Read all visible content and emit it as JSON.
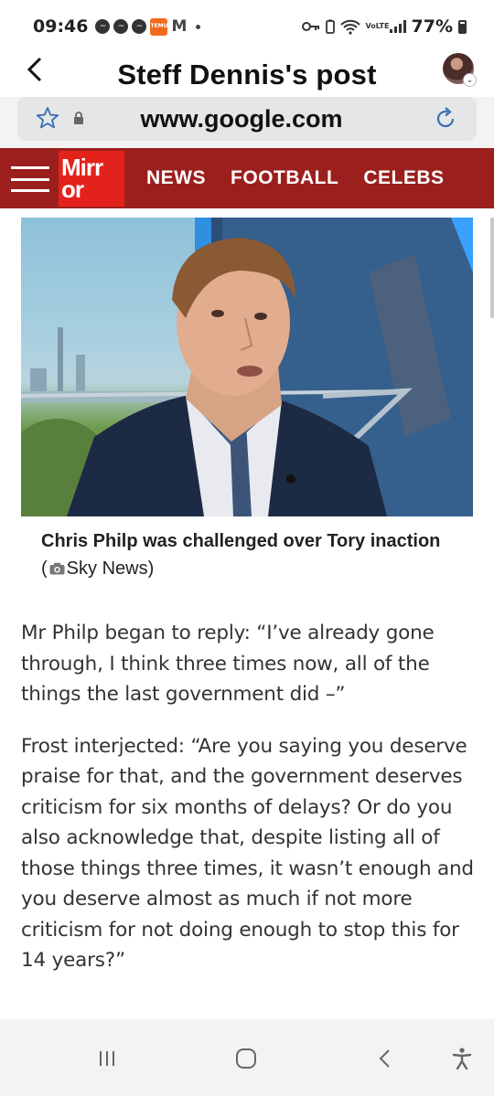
{
  "status_bar": {
    "time": "09:46",
    "notification_icons": [
      "messenger-icon",
      "messenger-icon",
      "messenger-icon",
      "temu-icon",
      "gmail-icon",
      "dot-icon"
    ],
    "temu_label": "TEMU",
    "volte_label": "VoLTE",
    "battery": "77%"
  },
  "header": {
    "title": "Steff Dennis's post"
  },
  "url_bar": {
    "url": "www.google.com"
  },
  "mirror_nav": {
    "logo": "Mirror",
    "links": [
      "NEWS",
      "FOOTBALL",
      "CELEBS"
    ],
    "brand_color": "#9b1f1d",
    "logo_color": "#e3231b"
  },
  "article": {
    "caption": "Chris Philp was challenged over Tory inaction",
    "caption_source": "Sky News",
    "paragraphs": [
      "Mr Philp began to reply: “I’ve already gone through, I think three times now, all of the things the last government did –”",
      "Frost interjected: “Are you saying you deserve praise for that, and the government deserves criticism for six months of delays? Or do you also acknowledge that, despite listing all of those things three times, it wasn’t enough and you deserve almost as much if not more criticism for not doing enough to stop this for 14 years?”"
    ]
  },
  "system_nav": {
    "buttons": [
      "recent-apps-icon",
      "home-icon",
      "back-icon",
      "accessibility-icon"
    ]
  }
}
